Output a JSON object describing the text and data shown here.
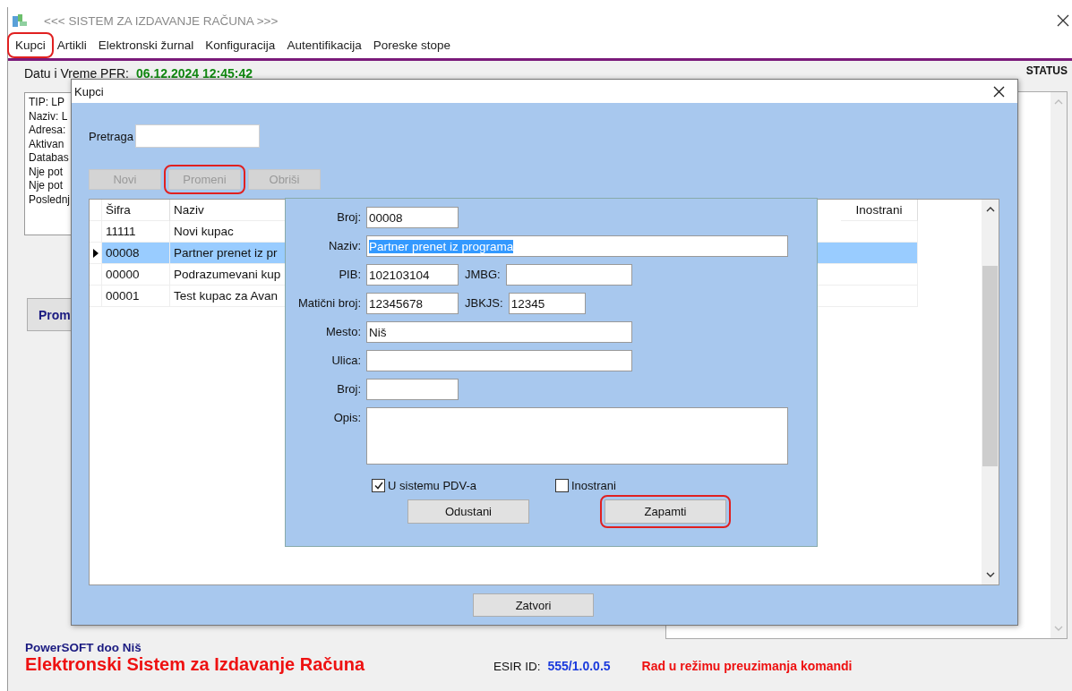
{
  "main_window": {
    "title": "<<< SISTEM ZA IZDAVANJE RAČUNA >>>",
    "menu": [
      {
        "label": "Kupci",
        "circled": true
      },
      {
        "label": "Artikli",
        "circled": false
      },
      {
        "label": "Elektronski žurnal",
        "circled": false
      },
      {
        "label": "Konfiguracija",
        "circled": false
      },
      {
        "label": "Autentifikacija",
        "circled": false
      },
      {
        "label": "Poreske stope",
        "circled": false
      }
    ],
    "pfr_label": "Datu i Vreme PFR:",
    "pfr_value": "06.12.2024 12:45:42",
    "info_lines": [
      "TIP: LP",
      "Naziv: L",
      "Adresa:",
      "Aktivan",
      "Databas",
      "Nje pot",
      "Nje pot",
      "Poslednj"
    ],
    "side_button": "Prom",
    "status_label": "STATUS"
  },
  "kupci_dialog": {
    "title": "Kupci",
    "search_label": "Pretraga",
    "buttons": [
      {
        "label": "Novi",
        "disabled": true,
        "circled": false
      },
      {
        "label": "Promeni",
        "disabled": true,
        "circled": true
      },
      {
        "label": "Obriši",
        "disabled": true,
        "circled": false
      }
    ],
    "table": {
      "columns": [
        "Šifra",
        "Naziv",
        "Inostrani"
      ],
      "rows": [
        {
          "cells": [
            "11111",
            "Novi kupac"
          ],
          "selected": false
        },
        {
          "cells": [
            "00008",
            "Partner prenet iz pr"
          ],
          "selected": true
        },
        {
          "cells": [
            "00000",
            "Podrazumevani kup"
          ],
          "selected": false
        },
        {
          "cells": [
            "00001",
            "Test kupac za Avan"
          ],
          "selected": false
        }
      ]
    },
    "close_button": "Zatvori"
  },
  "edit_form": {
    "rows": [
      {
        "fields": [
          {
            "label": "Broj:",
            "value": "00008",
            "kind": "short"
          }
        ]
      },
      {
        "fields": [
          {
            "label": "Naziv:",
            "value": "Partner prenet iz programa",
            "kind": "long",
            "text_selected": true
          }
        ]
      },
      {
        "fields": [
          {
            "label": "PIB:",
            "value": "102103104",
            "kind": "short"
          },
          {
            "label": "JMBG:",
            "kind": "medium"
          }
        ]
      },
      {
        "fields": [
          {
            "label": "Matični broj:",
            "value": "12345678",
            "kind": "short"
          },
          {
            "label": "JBKJS:",
            "value": "12345",
            "kind": "small"
          }
        ]
      },
      {
        "fields": [
          {
            "label": "Mesto:",
            "value": "Niš",
            "kind": "wide"
          }
        ]
      },
      {
        "fields": [
          {
            "label": "Ulica:",
            "kind": "wide"
          }
        ]
      },
      {
        "fields": [
          {
            "label": "Broj:",
            "kind": "short"
          }
        ]
      },
      {
        "fields": [
          {
            "label": "Opis:",
            "kind": "multiline"
          }
        ]
      }
    ],
    "checkboxes": [
      {
        "label": "U sistemu PDV-a",
        "checked": true
      },
      {
        "label": "Inostrani",
        "checked": false
      }
    ],
    "buttons": [
      {
        "label": "Odustani",
        "circled": false
      },
      {
        "label": "Zapamti",
        "circled": true
      }
    ]
  },
  "footer": {
    "company": "PowerSOFT doo Niš",
    "product": "Elektronski Sistem za Izdavanje Računa",
    "esir_label": "ESIR ID:",
    "esir_value": "555/1.0.0.5",
    "mode": "Rad u režimu preuzimanja komandi"
  }
}
